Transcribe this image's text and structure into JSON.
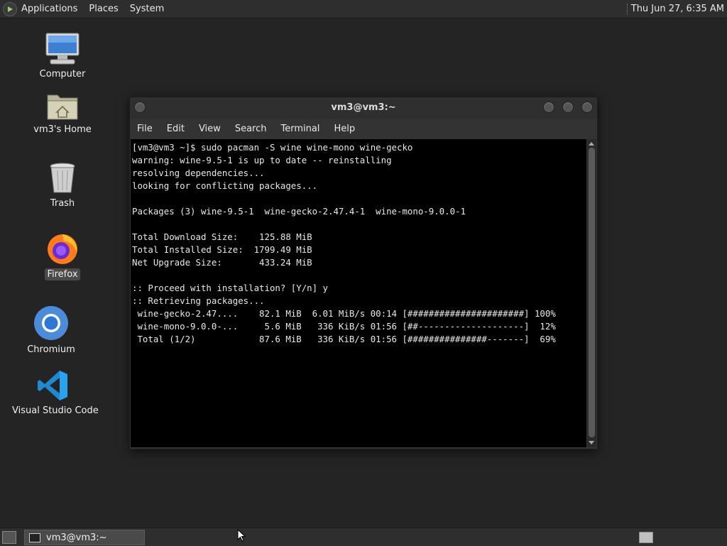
{
  "top_panel": {
    "menus": [
      "Applications",
      "Places",
      "System"
    ],
    "clock": "Thu Jun 27,  6:35 AM"
  },
  "desktop_icons": [
    {
      "label": "Computer",
      "icon": "computer-icon"
    },
    {
      "label": "vm3's Home",
      "icon": "home-folder-icon"
    },
    {
      "label": "Trash",
      "icon": "trash-icon"
    },
    {
      "label": "Firefox",
      "icon": "firefox-icon"
    },
    {
      "label": "Chromium",
      "icon": "chromium-icon"
    },
    {
      "label": "Visual Studio Code",
      "icon": "vscode-icon"
    }
  ],
  "terminal": {
    "title": "vm3@vm3:~",
    "menu": [
      "File",
      "Edit",
      "View",
      "Search",
      "Terminal",
      "Help"
    ],
    "lines": [
      "[vm3@vm3 ~]$ sudo pacman -S wine wine-mono wine-gecko",
      "warning: wine-9.5-1 is up to date -- reinstalling",
      "resolving dependencies...",
      "looking for conflicting packages...",
      "",
      "Packages (3) wine-9.5-1  wine-gecko-2.47.4-1  wine-mono-9.0.0-1",
      "",
      "Total Download Size:    125.88 MiB",
      "Total Installed Size:  1799.49 MiB",
      "Net Upgrade Size:       433.24 MiB",
      "",
      ":: Proceed with installation? [Y/n] y",
      ":: Retrieving packages...",
      " wine-gecko-2.47....    82.1 MiB  6.01 MiB/s 00:14 [######################] 100%",
      " wine-mono-9.0.0-...     5.6 MiB   336 KiB/s 01:56 [##--------------------]  12%",
      " Total (1/2)            87.6 MiB   336 KiB/s 01:56 [###############-------]  69%"
    ]
  },
  "taskbar": {
    "window_button": "vm3@vm3:~"
  }
}
